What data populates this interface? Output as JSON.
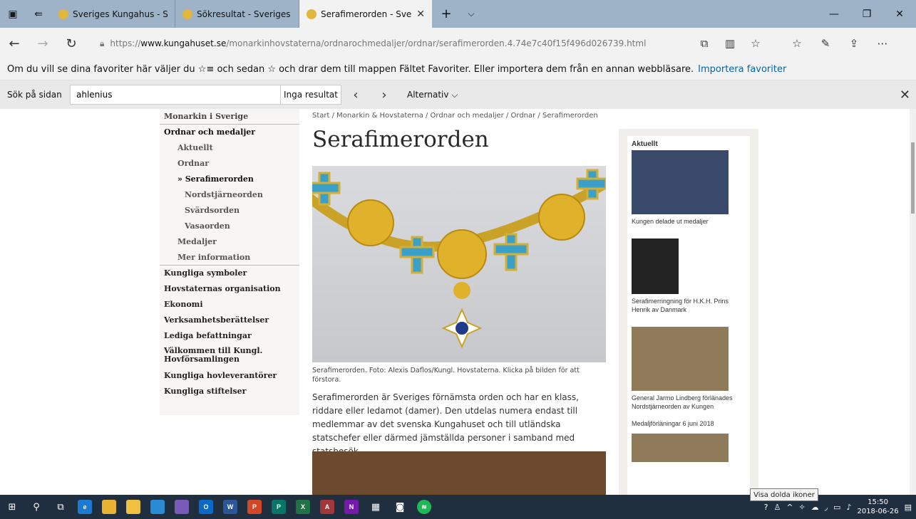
{
  "tabs": [
    {
      "title": "Sveriges Kungahus - Sverige"
    },
    {
      "title": "Sökresultat - Sveriges Kung"
    },
    {
      "title": "Serafimerorden - Sverig"
    }
  ],
  "address": {
    "prefix": "https://",
    "domain": "www.kungahuset.se",
    "path": "/monarkinhovstaterna/ordnarochmedaljer/ordnar/serafimerorden.4.74e7c40f15f496d026739.html"
  },
  "favbar": {
    "text": "Om du vill se dina favoriter här väljer du ☆≡ och sedan ☆ och drar dem till mappen Fältet Favoriter. Eller importera dem från en annan webbläsare.",
    "link": "Importera favoriter"
  },
  "find": {
    "label": "Sök på sidan",
    "value": "ahlenius",
    "result": "Inga resultat",
    "options": "Alternativ"
  },
  "leftnav": {
    "items": [
      "Monarkin i Sverige",
      "Ordnar och medaljer",
      "Aktuellt",
      "Ordnar",
      "» Serafimerorden",
      "Nordstjärneorden",
      "Svärdsorden",
      "Vasaorden",
      "Medaljer",
      "Mer information",
      "Kungliga symboler",
      "Hovstaternas organisation",
      "Ekonomi",
      "Verksamhetsberättelser",
      "Lediga befattningar",
      "Välkommen till Kungl. Hovförsamlingen",
      "Kungliga hovleverantörer",
      "Kungliga stiftelser"
    ]
  },
  "main": {
    "breadcrumb": "Start / Monarkin & Hovstaterna / Ordnar och medaljer / Ordnar / Serafimerorden",
    "title": "Serafimerorden",
    "caption": "Serafimerorden. Foto: Alexis Daflos/Kungl. Hovstaterna. Klicka på bilden för att förstora.",
    "body": "Serafimerorden är Sveriges förnämsta orden och har en klass, riddare eller ledamot (damer). Den utdelas numera endast till medlemmar av det svenska Kungahuset och till utländska statschefer eller därmed jämställda personer i samband med statsbesök."
  },
  "aside": {
    "heading": "Aktuellt",
    "news": [
      "Kungen delade ut medaljer",
      "Serafimerringning för H.K.H. Prins Henrik av Danmark",
      "General Jarmo Lindberg förlänades Nordstjärneorden av Kungen",
      "Medaljförläningar 6 juni 2018"
    ]
  },
  "tooltip": "Visa dolda ikoner",
  "clock": {
    "time": "15:50",
    "date": "2018-06-26"
  }
}
